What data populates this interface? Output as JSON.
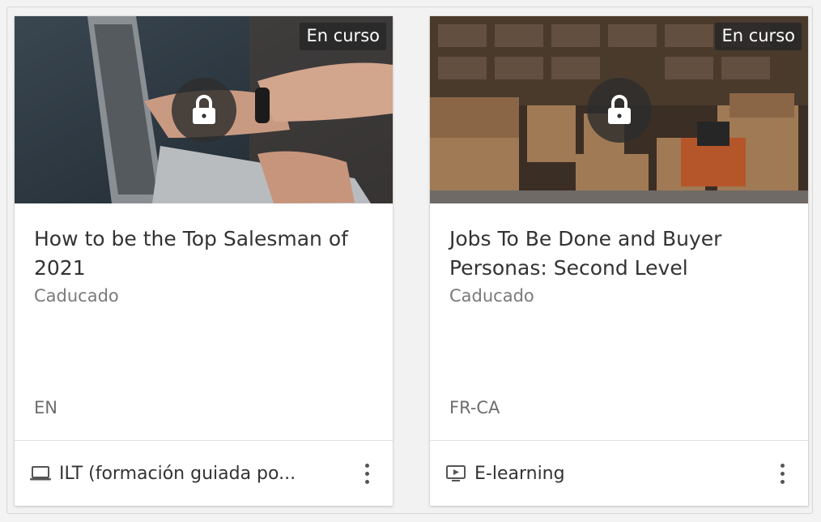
{
  "cards": [
    {
      "badge": "En curso",
      "title": "How to be the Top Salesman of 2021",
      "status": "Caducado",
      "language": "EN",
      "type_label": "ILT (formación guiada po...",
      "type_icon": "laptop-icon"
    },
    {
      "badge": "En curso",
      "title": "Jobs To Be Done and Buyer Personas: Second Level",
      "status": "Caducado",
      "language": "FR-CA",
      "type_label": "E-learning",
      "type_icon": "video-play-icon"
    }
  ],
  "colors": {
    "badge_bg": "#282828",
    "title": "#333333",
    "status": "#7a7a7a"
  }
}
